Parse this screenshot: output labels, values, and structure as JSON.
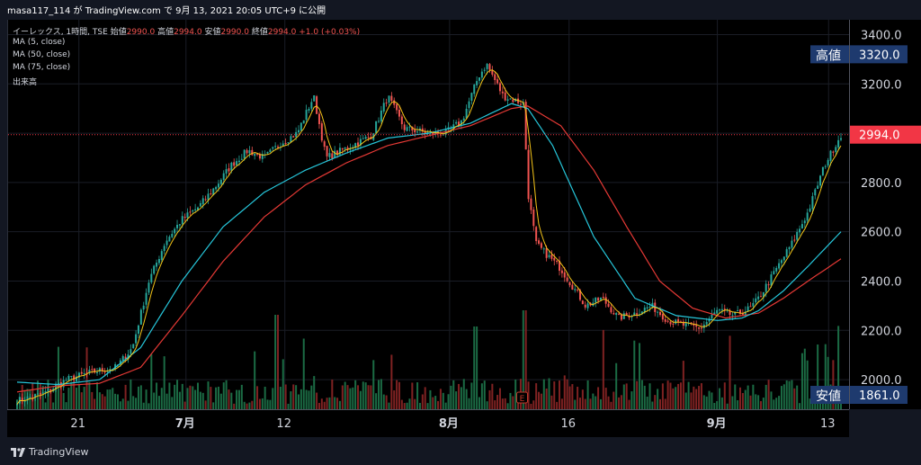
{
  "header": {
    "caption": "masa117_114 が TradingView.com で 9月 13, 2021 20:05 UTC+9 に公開"
  },
  "legend": {
    "symbol": "イーレックス, 1時間, TSE",
    "open_label": "始値",
    "open": "2990.0",
    "high_label": "高値",
    "high": "2994.0",
    "low_label": "安値",
    "low": "2990.0",
    "close_label": "終値",
    "close": "2994.0",
    "change": "+1.0 (+0.03%)",
    "ma5": "MA (5, close)",
    "ma50": "MA (50, close)",
    "ma75": "MA (75, close)",
    "volume": "出来高"
  },
  "footer": {
    "brand": "TradingView"
  },
  "colors": {
    "up": "#26a69a",
    "down": "#ef5350",
    "ma5": "#f5c518",
    "ma50": "#26c6da",
    "ma75": "#e53935",
    "vol_up": "#1b6b44",
    "vol_down": "#7f2222",
    "price_tag": "#f23645",
    "label_box": "#1e3a6e"
  },
  "chart_data": {
    "type": "line",
    "description_series": "hourly candlestick price with moving averages and volume",
    "ylim": [
      1880,
      3460
    ],
    "yticks": [
      2000,
      2200,
      2400,
      2600,
      2800,
      3000,
      3200,
      3400
    ],
    "yticklabels": [
      "2000.0",
      "2200.0",
      "2400.0",
      "2600.0",
      "2800.0",
      "",
      "3200.0",
      "3400.0"
    ],
    "xticks": [
      {
        "label": "21",
        "t": 0.075
      },
      {
        "label": "7月",
        "t": 0.205,
        "bold": true
      },
      {
        "label": "12",
        "t": 0.325
      },
      {
        "label": "8月",
        "t": 0.525,
        "bold": true
      },
      {
        "label": "16",
        "t": 0.67
      },
      {
        "label": "9月",
        "t": 0.85,
        "bold": true
      },
      {
        "label": "13",
        "t": 0.985
      }
    ],
    "price_anchors": [
      [
        0.0,
        1915
      ],
      [
        0.03,
        1940
      ],
      [
        0.06,
        2000
      ],
      [
        0.09,
        2030
      ],
      [
        0.12,
        2050
      ],
      [
        0.14,
        2130
      ],
      [
        0.16,
        2400
      ],
      [
        0.18,
        2560
      ],
      [
        0.2,
        2650
      ],
      [
        0.22,
        2700
      ],
      [
        0.24,
        2780
      ],
      [
        0.26,
        2870
      ],
      [
        0.28,
        2930
      ],
      [
        0.3,
        2900
      ],
      [
        0.32,
        2960
      ],
      [
        0.34,
        3000
      ],
      [
        0.36,
        3150
      ],
      [
        0.375,
        2900
      ],
      [
        0.4,
        2940
      ],
      [
        0.43,
        2990
      ],
      [
        0.45,
        3150
      ],
      [
        0.47,
        3020
      ],
      [
        0.5,
        3000
      ],
      [
        0.52,
        3000
      ],
      [
        0.54,
        3050
      ],
      [
        0.56,
        3230
      ],
      [
        0.57,
        3280
      ],
      [
        0.59,
        3150
      ],
      [
        0.615,
        3120
      ],
      [
        0.62,
        2760
      ],
      [
        0.63,
        2550
      ],
      [
        0.66,
        2450
      ],
      [
        0.69,
        2300
      ],
      [
        0.71,
        2330
      ],
      [
        0.73,
        2250
      ],
      [
        0.75,
        2270
      ],
      [
        0.77,
        2300
      ],
      [
        0.79,
        2240
      ],
      [
        0.81,
        2220
      ],
      [
        0.83,
        2210
      ],
      [
        0.85,
        2280
      ],
      [
        0.87,
        2260
      ],
      [
        0.89,
        2290
      ],
      [
        0.9,
        2330
      ],
      [
        0.92,
        2440
      ],
      [
        0.94,
        2550
      ],
      [
        0.96,
        2680
      ],
      [
        0.98,
        2870
      ],
      [
        1.0,
        2994
      ]
    ],
    "ma50_anchors": [
      [
        0.0,
        1990
      ],
      [
        0.05,
        1980
      ],
      [
        0.1,
        2000
      ],
      [
        0.15,
        2130
      ],
      [
        0.2,
        2400
      ],
      [
        0.25,
        2620
      ],
      [
        0.3,
        2760
      ],
      [
        0.35,
        2850
      ],
      [
        0.4,
        2920
      ],
      [
        0.45,
        2980
      ],
      [
        0.5,
        3000
      ],
      [
        0.55,
        3040
      ],
      [
        0.6,
        3120
      ],
      [
        0.62,
        3100
      ],
      [
        0.65,
        2950
      ],
      [
        0.7,
        2580
      ],
      [
        0.75,
        2330
      ],
      [
        0.8,
        2260
      ],
      [
        0.85,
        2240
      ],
      [
        0.88,
        2250
      ],
      [
        0.9,
        2280
      ],
      [
        0.93,
        2360
      ],
      [
        0.96,
        2460
      ],
      [
        1.0,
        2600
      ]
    ],
    "ma75_anchors": [
      [
        0.0,
        1950
      ],
      [
        0.05,
        1975
      ],
      [
        0.1,
        1985
      ],
      [
        0.15,
        2050
      ],
      [
        0.2,
        2260
      ],
      [
        0.25,
        2480
      ],
      [
        0.3,
        2660
      ],
      [
        0.35,
        2790
      ],
      [
        0.4,
        2880
      ],
      [
        0.45,
        2950
      ],
      [
        0.5,
        2990
      ],
      [
        0.55,
        3030
      ],
      [
        0.6,
        3100
      ],
      [
        0.62,
        3110
      ],
      [
        0.66,
        3030
      ],
      [
        0.7,
        2850
      ],
      [
        0.74,
        2620
      ],
      [
        0.78,
        2400
      ],
      [
        0.82,
        2290
      ],
      [
        0.86,
        2250
      ],
      [
        0.9,
        2270
      ],
      [
        0.93,
        2330
      ],
      [
        0.96,
        2400
      ],
      [
        1.0,
        2490
      ]
    ],
    "last_price": "2994.0",
    "last_value": 2994,
    "high_label": "高値",
    "high_value": "3320.0",
    "high_num": 3320,
    "low_label": "安値",
    "low_value": "1861.0",
    "event_marker": "E",
    "event_t": 0.613
  }
}
